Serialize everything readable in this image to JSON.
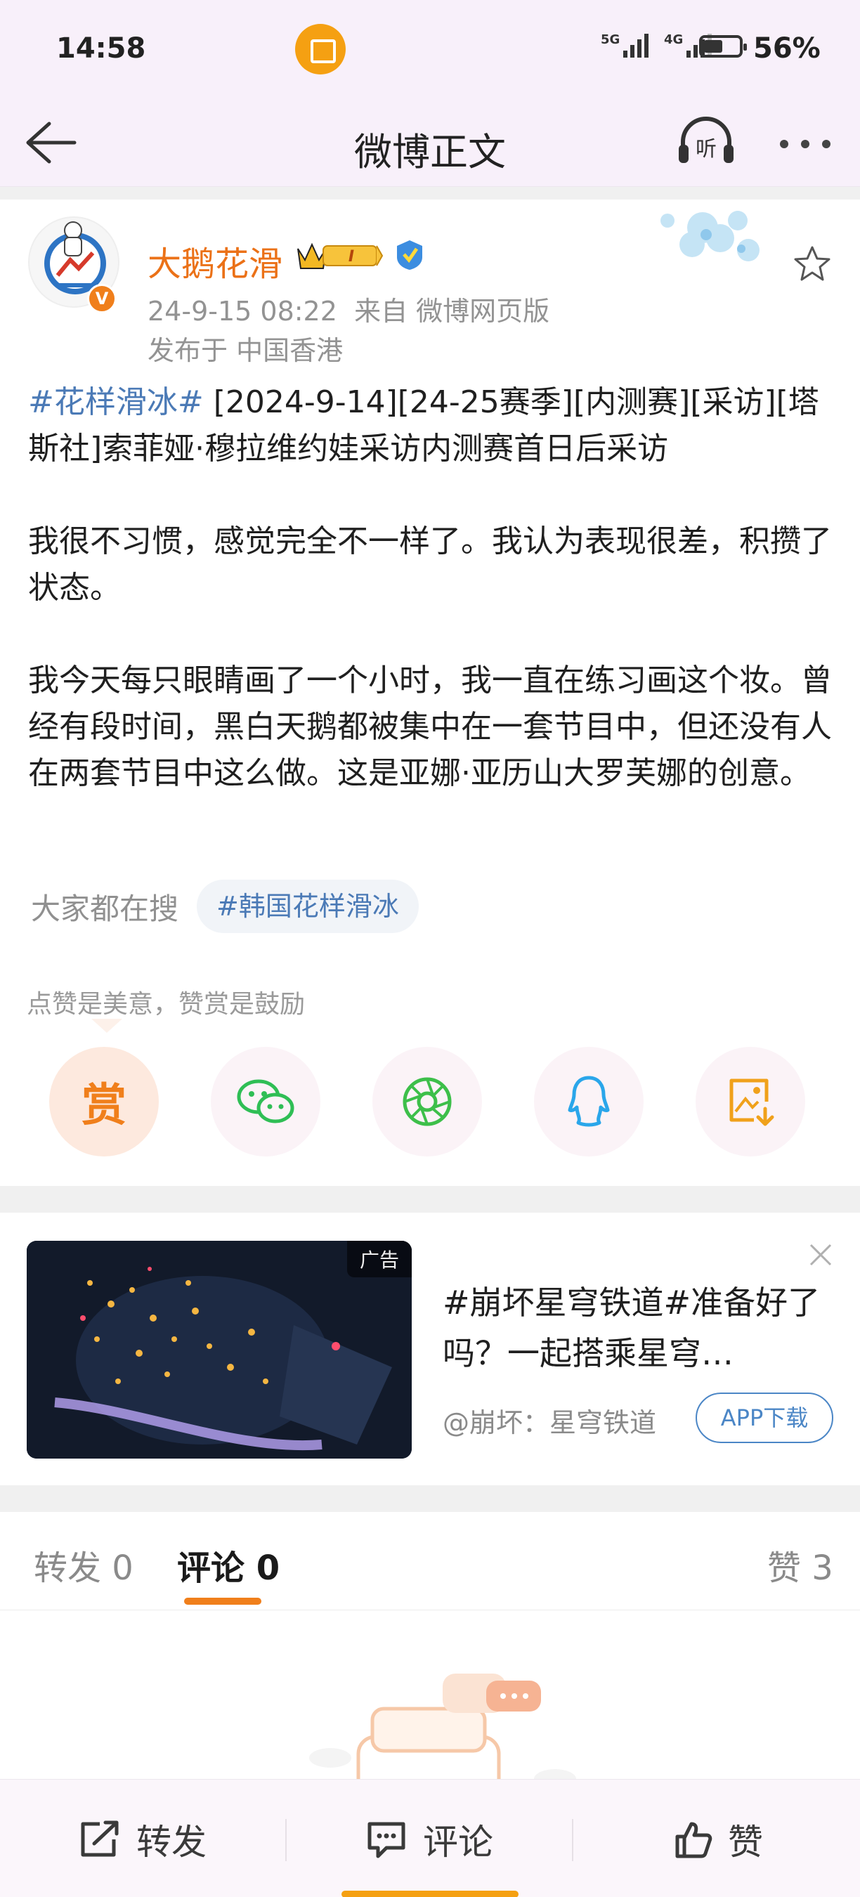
{
  "status_bar": {
    "time": "14:58",
    "signal_1_label": "5G",
    "signal_2_label": "4G",
    "battery": "56%"
  },
  "nav": {
    "title": "微博正文",
    "listen_label": "听"
  },
  "post": {
    "username": "大鹅花滑",
    "vip_level": "I",
    "verified_mark": "V",
    "timestamp": "24-9-15 08:22",
    "source": "来自 微博网页版",
    "location": "发布于 中国香港",
    "tag": "#花样滑冰#",
    "paragraph1": " [2024-9-14][24-25赛季][内测赛][采访][塔斯社]索菲娅·穆拉维约娃采访内测赛首日后采访",
    "paragraph2": "我很不习惯，感觉完全不一样了。我认为表现很差，积攒了状态。",
    "paragraph3": "我今天每只眼睛画了一个小时，我一直在练习画这个妆。曾经有段时间，黑白天鹅都被集中在一套节目中，但还没有人在两套节目中这么做。这是亚娜·亚历山大罗芙娜的创意。",
    "search_label": "大家都在搜",
    "search_chip": "#韩国花样滑冰",
    "reward_text": "点赞是美意，赞赏是鼓励",
    "reward_button": "赏"
  },
  "share_icons": [
    "reward-icon",
    "wechat-icon",
    "moments-icon",
    "qq-icon",
    "save-image-icon"
  ],
  "ad": {
    "label": "广告",
    "title": "#崩坏星穹铁道#准备好了吗？一起搭乘星穹…",
    "source": "@崩坏：星穹铁道",
    "button": "APP下载"
  },
  "tabs": {
    "repost": "转发 0",
    "comment": "评论 0",
    "like": "赞 3"
  },
  "bottom_bar": {
    "repost": "转发",
    "comment": "评论",
    "like": "赞"
  },
  "colors": {
    "accent": "#f07f1b",
    "link": "#4b7ab6",
    "username": "#eb7117",
    "page_bg": "#f8f0fa"
  }
}
